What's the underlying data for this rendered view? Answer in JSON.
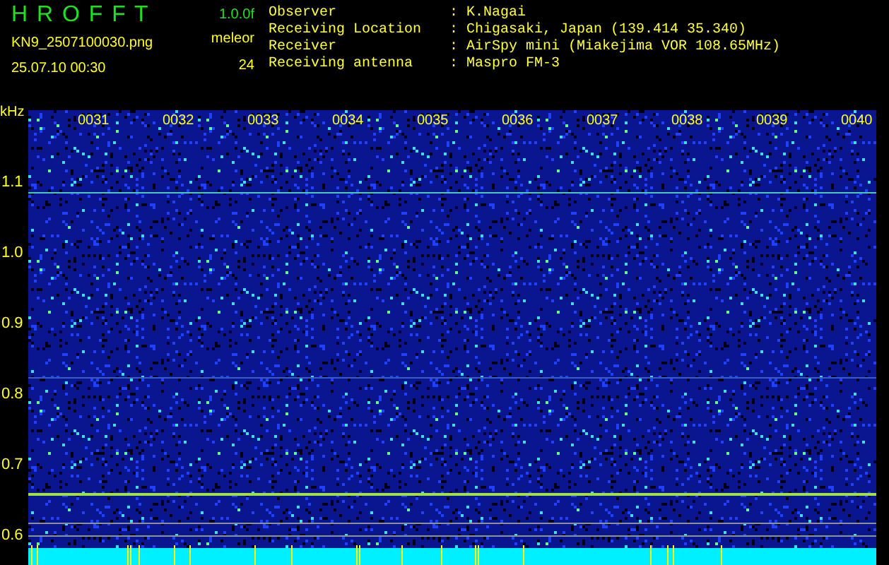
{
  "header": {
    "app_name": "H R O F F T",
    "version": "1.0.0f",
    "filename": "KN9_2507100030.png",
    "datetime": "25.07.10 00:30",
    "counter_label": "meleor",
    "count": "24"
  },
  "info": [
    {
      "label": "Observer",
      "separator": ":",
      "value": "K.Nagai"
    },
    {
      "label": "Receiving Location",
      "separator": ":",
      "value": "Chigasaki, Japan (139.414 35.340)"
    },
    {
      "label": "Receiver",
      "separator": ":",
      "value": "AirSpy mini (Miakejima VOR 108.65MHz)"
    },
    {
      "label": "Receiving antenna",
      "separator": ":",
      "value": "Maspro FM-3"
    }
  ],
  "spectrogram": {
    "unit": "kHz",
    "y_labels": [
      "1.1",
      "1.0",
      "0.9",
      "0.8",
      "0.7",
      "0.6"
    ],
    "time_labels": [
      "0031",
      "0032",
      "0033",
      "0034",
      "0035",
      "0036",
      "0037",
      "0038",
      "0039",
      "0040"
    ]
  }
}
